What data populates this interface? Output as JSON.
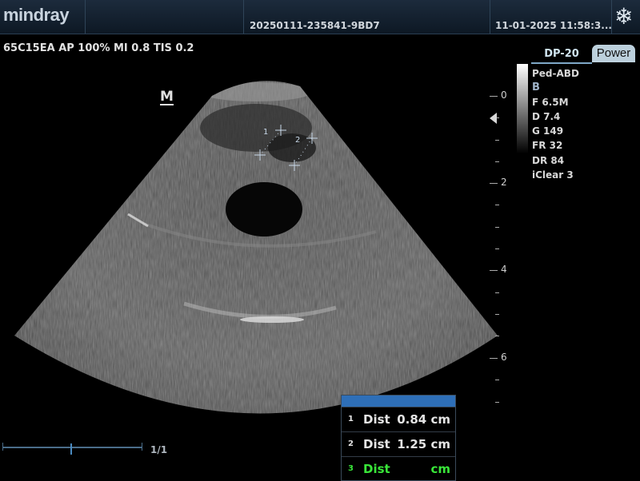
{
  "header": {
    "brand": "mindray",
    "exam_id": "20250111-235841-9BD7",
    "datetime": "11-01-2025 11:58:3...",
    "freeze_icon": "snowflake-icon"
  },
  "probe_info": "65C15EA  AP 100%  MI 0.8  TIS 0.2",
  "image_marker": "M",
  "depth_scale": {
    "labels": [
      "0",
      "2",
      "4",
      "6"
    ]
  },
  "preset": {
    "tab": "DP-20",
    "power_tab": "Power",
    "name": "Ped-ABD"
  },
  "imaging_params": {
    "mode": "B",
    "freq": "F 6.5M",
    "depth": "D 7.4",
    "gain": "G 149",
    "frame_rate": "FR 32",
    "dyn_range": "DR 84",
    "iclear": "iClear 3"
  },
  "calipers": {
    "labels": [
      "1",
      "2"
    ]
  },
  "measurements": [
    {
      "index": "1",
      "name": "Dist",
      "value": "0.84 cm"
    },
    {
      "index": "2",
      "name": "Dist",
      "value": "1.25 cm"
    },
    {
      "index": "3",
      "name": "Dist",
      "value": "cm"
    }
  ],
  "cine": {
    "counter": "1/1"
  },
  "colors": {
    "active_measurement": "#39e639",
    "panel_header": "#2e6fb8"
  }
}
